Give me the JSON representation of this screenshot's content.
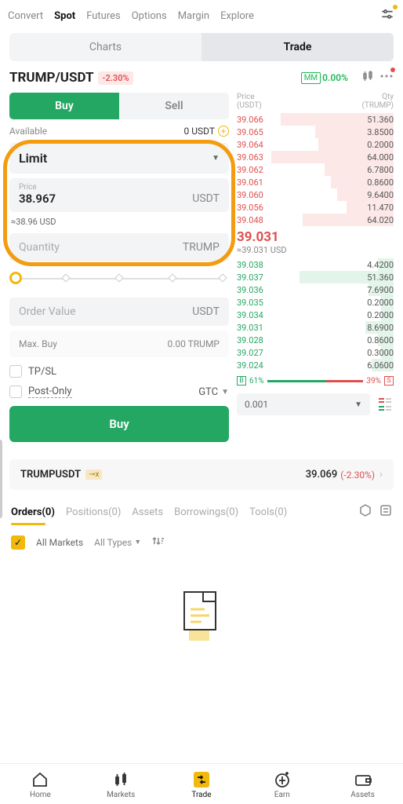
{
  "topnav": {
    "items": [
      "Convert",
      "Spot",
      "Futures",
      "Options",
      "Margin",
      "Explore"
    ],
    "active": 1
  },
  "subtabs": {
    "items": [
      "Charts",
      "Trade"
    ],
    "active": 1
  },
  "pair": {
    "symbol": "TRUMP/USDT",
    "change_pct": "-2.30%",
    "mm_pct": "0.00%",
    "mm_label": "MM"
  },
  "buysell": {
    "buy": "Buy",
    "sell": "Sell"
  },
  "available": {
    "label": "Available",
    "value": "0 USDT"
  },
  "limit": {
    "label": "Limit"
  },
  "price": {
    "label": "Price",
    "value": "38.967",
    "unit": "USDT",
    "approx": "≈38.96 USD"
  },
  "qty": {
    "label": "Quantity",
    "unit": "TRUMP"
  },
  "order_value": {
    "label": "Order Value",
    "unit": "USDT"
  },
  "maxbuy": {
    "label": "Max. Buy",
    "value": "0.00 TRUMP"
  },
  "tpsl": {
    "label": "TP/SL"
  },
  "postonly": {
    "label": "Post-Only",
    "gtc": "GTC"
  },
  "buy_btn": "Buy",
  "orderbook": {
    "price_label": "Price",
    "price_unit": "(USDT)",
    "qty_label": "Qty",
    "qty_unit": "(TRUMP)",
    "asks": [
      {
        "p": "39.066",
        "q": "51.360",
        "d": 72
      },
      {
        "p": "39.065",
        "q": "3.8500",
        "d": 50
      },
      {
        "p": "39.064",
        "q": "0.2000",
        "d": 48
      },
      {
        "p": "39.063",
        "q": "64.000",
        "d": 78
      },
      {
        "p": "39.062",
        "q": "6.7800",
        "d": 44
      },
      {
        "p": "39.061",
        "q": "0.8600",
        "d": 40
      },
      {
        "p": "39.060",
        "q": "9.6400",
        "d": 36
      },
      {
        "p": "39.056",
        "q": "11.470",
        "d": 30
      },
      {
        "p": "39.048",
        "q": "64.020",
        "d": 58
      }
    ],
    "mid": {
      "price": "39.031",
      "approx": "≈39.031 USD"
    },
    "bids": [
      {
        "p": "39.038",
        "q": "4.4200",
        "d": 10
      },
      {
        "p": "39.037",
        "q": "51.360",
        "d": 60
      },
      {
        "p": "39.036",
        "q": "7.6900",
        "d": 16
      },
      {
        "p": "39.035",
        "q": "0.2000",
        "d": 8
      },
      {
        "p": "39.034",
        "q": "0.2000",
        "d": 8
      },
      {
        "p": "39.031",
        "q": "8.6900",
        "d": 18
      },
      {
        "p": "39.028",
        "q": "0.8600",
        "d": 10
      },
      {
        "p": "39.027",
        "q": "0.3000",
        "d": 8
      },
      {
        "p": "39.024",
        "q": "6.0600",
        "d": 14
      }
    ],
    "ratio": {
      "b_pct": "61%",
      "s_pct": "39%",
      "b": 61,
      "s": 39
    },
    "precision": "0.001"
  },
  "ticker": {
    "symbol": "TRUMPUSDT",
    "tag": "⊸x",
    "price": "39.069",
    "change": "(-2.30%)"
  },
  "btabs": {
    "items": [
      "Orders(0)",
      "Positions(0)",
      "Assets",
      "Borrowings(0)",
      "Tools(0)"
    ],
    "active": 0
  },
  "filters": {
    "all_markets": "All Markets",
    "all_types": "All Types"
  },
  "bottomnav": {
    "items": [
      "Home",
      "Markets",
      "Trade",
      "Earn",
      "Assets"
    ],
    "active": 2
  }
}
